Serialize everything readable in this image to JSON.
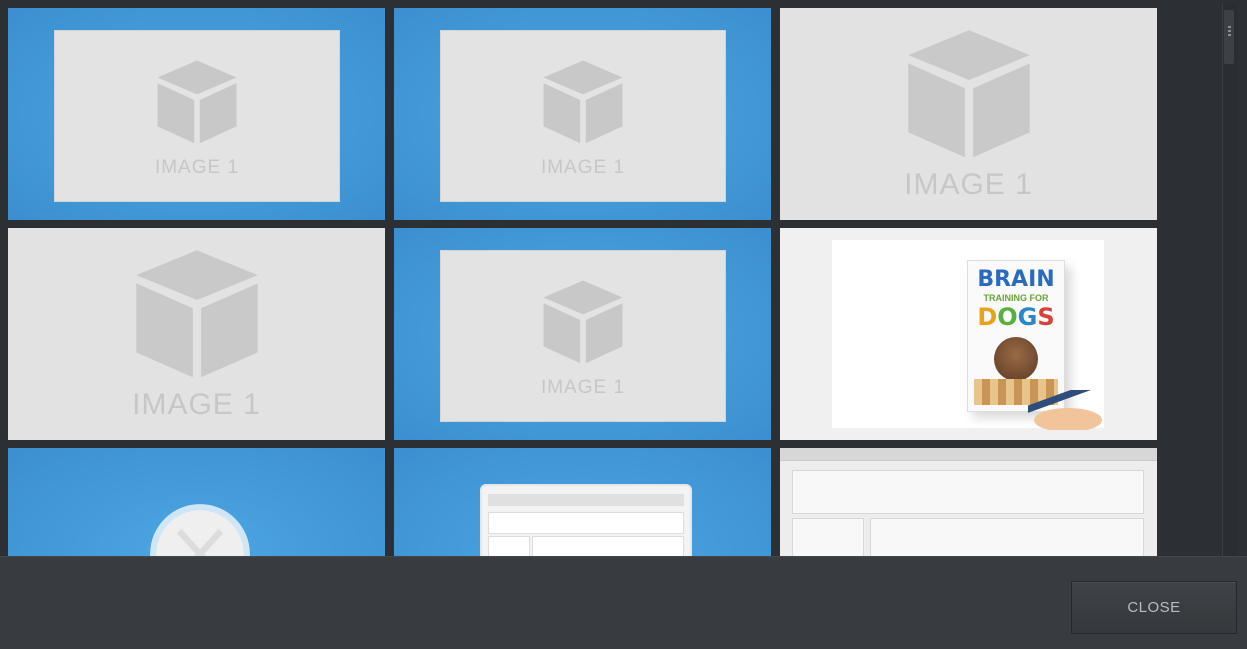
{
  "tiles": [
    {
      "caption": "IMAGE 1",
      "selected": true
    },
    {
      "caption": "IMAGE 1",
      "selected": true
    },
    {
      "caption": "IMAGE 1",
      "selected": false
    },
    {
      "caption": "IMAGE 1",
      "selected": false
    },
    {
      "caption": "IMAGE 1",
      "selected": true
    },
    {
      "caption": "",
      "selected": false,
      "kind": "book"
    },
    {
      "caption": "",
      "selected": true,
      "kind": "badge"
    },
    {
      "caption": "",
      "selected": true,
      "kind": "browser-screenshot"
    },
    {
      "caption": "",
      "selected": false,
      "kind": "app-screenshot"
    }
  ],
  "book": {
    "title_line1": "BRAIN",
    "title_line2": "TRAINING FOR",
    "title_line3": [
      "D",
      "O",
      "G",
      "S"
    ]
  },
  "footer": {
    "close_label": "CLOSE"
  },
  "colors": {
    "selected": "#3b8fd0",
    "placeholder": "#e3e3e3",
    "footer": "#383b3f"
  }
}
